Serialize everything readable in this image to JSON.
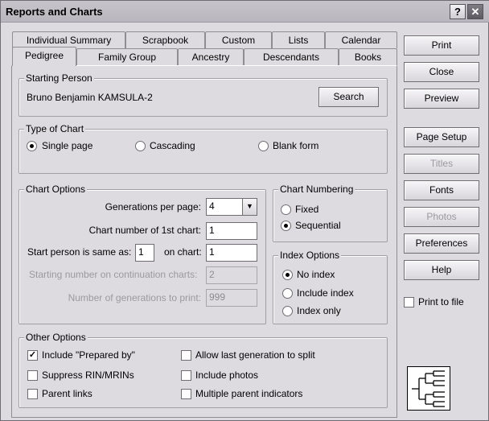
{
  "window": {
    "title": "Reports and Charts"
  },
  "titlebar": {
    "help_glyph": "?",
    "close_glyph": "✕"
  },
  "tabs_top": [
    "Individual Summary",
    "Scrapbook",
    "Custom",
    "Lists",
    "Calendar"
  ],
  "tabs_bottom": [
    "Pedigree",
    "Family Group",
    "Ancestry",
    "Descendants",
    "Books"
  ],
  "starting_person": {
    "legend": "Starting Person",
    "name": "Bruno Benjamin KAMSULA-2",
    "search_label": "Search"
  },
  "chart_type": {
    "legend": "Type of Chart",
    "options": [
      "Single page",
      "Cascading",
      "Blank form"
    ],
    "selected": "Single page"
  },
  "chart_options": {
    "legend": "Chart Options",
    "generations_label": "Generations per page:",
    "generations_value": "4",
    "first_chart_label": "Chart number of 1st chart:",
    "first_chart_value": "1",
    "start_same_label": "Start person is same as:",
    "start_same_value": "1",
    "on_chart_label": "on chart:",
    "on_chart_value": "1",
    "continuation_label": "Starting number on continuation charts:",
    "continuation_value": "2",
    "gens_print_label": "Number of generations to print:",
    "gens_print_value": "999"
  },
  "chart_numbering": {
    "legend": "Chart Numbering",
    "options": [
      "Fixed",
      "Sequential"
    ],
    "selected": "Sequential"
  },
  "index_options": {
    "legend": "Index Options",
    "options": [
      "No index",
      "Include index",
      "Index only"
    ],
    "selected": "No index"
  },
  "other_options": {
    "legend": "Other Options",
    "prepared_by": "Include \"Prepared by\"",
    "suppress_rin": "Suppress RIN/MRINs",
    "parent_links": "Parent links",
    "allow_split": "Allow last generation to split",
    "include_photos": "Include photos",
    "multiple_parent": "Multiple parent indicators"
  },
  "checks": {
    "on_mark": "✓"
  },
  "side_buttons": {
    "print": "Print",
    "close": "Close",
    "preview": "Preview",
    "page_setup": "Page Setup",
    "titles": "Titles",
    "fonts": "Fonts",
    "photos": "Photos",
    "preferences": "Preferences",
    "help": "Help"
  },
  "print_to_file": {
    "label": "Print to file",
    "checked": false
  },
  "icons": {
    "pedigree_chart": "pedigree-chart-icon",
    "dropdown": "chevron-down-icon"
  }
}
